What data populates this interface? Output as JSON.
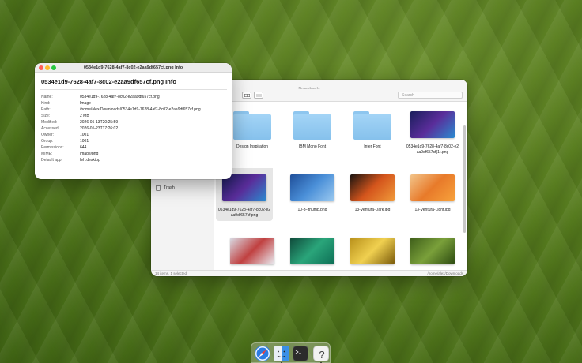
{
  "finder": {
    "title": "Downloads",
    "search_placeholder": "Search",
    "sidebar": {
      "trash": "Trash"
    },
    "items": [
      {
        "label": "Design Inspiration",
        "kind": "folder"
      },
      {
        "label": "IBM Mono Font",
        "kind": "folder"
      },
      {
        "label": "Inter Font",
        "kind": "folder"
      },
      {
        "label": "0534e1d9-7628-4af7-8c02-e2aa9df657cf(1).png",
        "kind": "image",
        "colors": [
          "#1a1e5c",
          "#5a2d9a",
          "#2a8bd0"
        ]
      },
      {
        "label": "0534e1d9-7628-4af7-8c02-e2aa9df657cf.png",
        "kind": "image",
        "colors": [
          "#1a1e5c",
          "#5a2d9a",
          "#2a8bd0"
        ],
        "selected": true
      },
      {
        "label": "10-3--thumb.png",
        "kind": "image",
        "colors": [
          "#1f4f9a",
          "#4a8fd8",
          "#9ccaf0"
        ]
      },
      {
        "label": "13-Ventura-Dark.jpg",
        "kind": "image",
        "colors": [
          "#1a1410",
          "#d4551c",
          "#f09a3a"
        ]
      },
      {
        "label": "13-Ventura-Light.jpg",
        "kind": "image",
        "colors": [
          "#f2c48a",
          "#e87a2a",
          "#f7a23c"
        ]
      },
      {
        "label": "",
        "kind": "image",
        "colors": [
          "#d9dde6",
          "#c04040",
          "#e9ecf2"
        ]
      },
      {
        "label": "",
        "kind": "image",
        "colors": [
          "#0f4a3a",
          "#2aa57a",
          "#0d6e55"
        ]
      },
      {
        "label": "",
        "kind": "image",
        "colors": [
          "#b8901a",
          "#f0d050",
          "#7a5a0a"
        ]
      },
      {
        "label": "",
        "kind": "image",
        "colors": [
          "#3e5e1a",
          "#7aa03a",
          "#2c4a10"
        ]
      }
    ],
    "status_left": "14 items, 1 selected",
    "status_right": "/home/alex/Downloads"
  },
  "info": {
    "title": "0534e1d9-7628-4af7-8c02-e2aa9df657cf.png Info",
    "heading": "0534e1d9-7628-4af7-8c02-e2aa9df657cf.png Info",
    "rows": [
      {
        "key": "Name:",
        "value": "0534e1d9-7628-4af7-8c02-e2aa9df657cf.png"
      },
      {
        "key": "Kind:",
        "value": "Image"
      },
      {
        "key": "Path:",
        "value": "/home/alex/Downloads/0534e1d9-7628-4af7-8c02-e2aa9df657cf.png"
      },
      {
        "key": "Size:",
        "value": "2 MB"
      },
      {
        "key": "Modified:",
        "value": "2026-05-13T20:25:59"
      },
      {
        "key": "Accessed:",
        "value": "2026-05-23T17:26:02"
      },
      {
        "key": "Owner:",
        "value": "1001"
      },
      {
        "key": "Group:",
        "value": "1001"
      },
      {
        "key": "Permissions:",
        "value": "644"
      },
      {
        "key": "MIME:",
        "value": "image/png"
      },
      {
        "key": "Default app:",
        "value": "feh.desktop"
      }
    ]
  },
  "dock": {
    "apps": [
      {
        "name": "safari-icon",
        "color": "#2a7be4"
      },
      {
        "name": "finder-icon",
        "color": "#3a8fe6"
      },
      {
        "name": "terminal-icon",
        "color": "#2b2b2b"
      },
      {
        "name": "help-icon",
        "color": "#f2f2f2"
      }
    ]
  },
  "colors": {
    "close": "#ff5f57",
    "minimize": "#febc2e",
    "maximize": "#28c840"
  }
}
